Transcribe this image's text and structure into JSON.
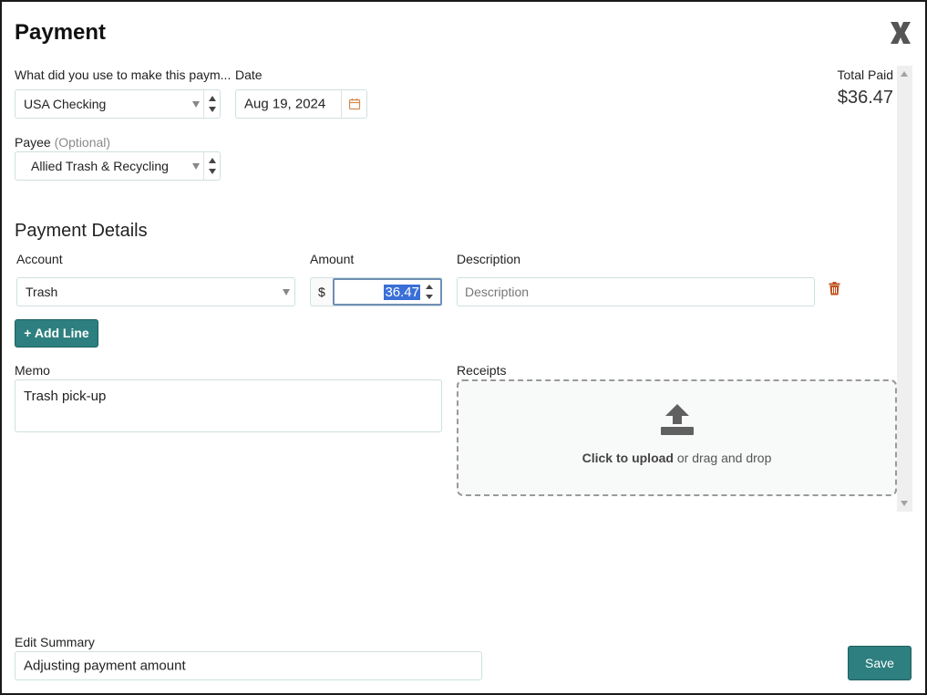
{
  "dialog": {
    "title": "Payment",
    "close_icon": "close-x-icon"
  },
  "payment_method": {
    "label": "What did you use to make this paym...",
    "value": "USA Checking"
  },
  "date": {
    "label": "Date",
    "value": "Aug 19, 2024",
    "icon": "calendar-icon"
  },
  "total": {
    "label": "Total Paid",
    "value": "$36.47"
  },
  "payee": {
    "label": "Payee",
    "optional": "(Optional)",
    "value": "Allied Trash & Recycling"
  },
  "details": {
    "title": "Payment Details",
    "columns": {
      "account": "Account",
      "amount": "Amount",
      "description": "Description"
    },
    "line": {
      "account": "Trash",
      "currency": "$",
      "amount": "36.47",
      "description_placeholder": "Description",
      "delete_icon": "trash-icon"
    },
    "add_line": "+ Add Line"
  },
  "memo": {
    "label": "Memo",
    "value": "Trash pick-up"
  },
  "receipts": {
    "label": "Receipts",
    "upload_bold": "Click to upload",
    "upload_rest": " or drag and drop",
    "icon": "upload-icon"
  },
  "edit_summary": {
    "label": "Edit Summary",
    "value": "Adjusting payment amount"
  },
  "save": "Save",
  "colors": {
    "accent": "#2e7f7f",
    "danger": "#c0521d",
    "border": "#cfe0e0",
    "highlight": "#3a6fd8"
  }
}
